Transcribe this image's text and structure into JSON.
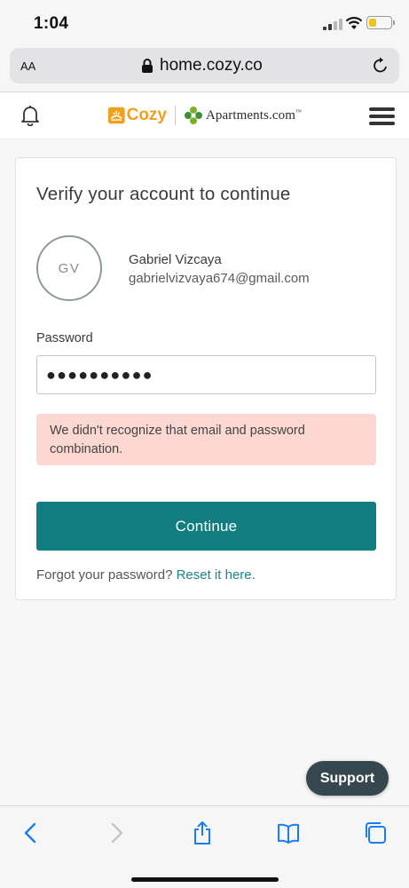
{
  "status_bar": {
    "time": "1:04",
    "battery_level": 0.35
  },
  "url_bar": {
    "text_size_label": "AA",
    "url": "home.cozy.co"
  },
  "header": {
    "brand": "Cozy",
    "partner": "Apartments.com",
    "partner_mark": "™"
  },
  "card": {
    "title": "Verify your account to continue",
    "avatar_initials": "GV",
    "user_name": "Gabriel Vizcaya",
    "user_email": "gabrielvizvaya674@gmail.com",
    "password_label": "Password",
    "password_value": "●●●●●●●●●●",
    "error_message": "We didn't recognize that email and password combination.",
    "continue_label": "Continue",
    "forgot_text": "Forgot your password?",
    "reset_link": "Reset it here."
  },
  "support_label": "Support",
  "colors": {
    "accent": "#127d7f",
    "error_bg": "#fdd8d2",
    "cozy_orange": "#f0a01c",
    "apartments_green": "#7bb026"
  }
}
